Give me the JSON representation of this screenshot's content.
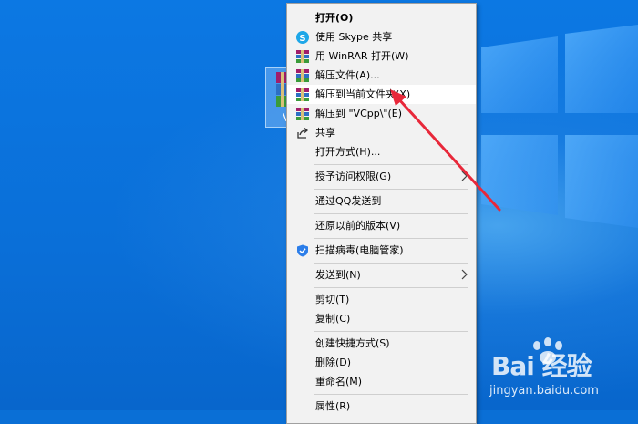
{
  "desktop": {
    "file_label": "V"
  },
  "context_menu": {
    "items": [
      {
        "label": "打开(O)",
        "icon": "none"
      },
      {
        "label": "使用 Skype 共享",
        "icon": "skype-icon"
      },
      {
        "label": "用 WinRAR 打开(W)",
        "icon": "winrar-icon"
      },
      {
        "label": "解压文件(A)...",
        "icon": "winrar-icon"
      },
      {
        "label": "解压到当前文件夹(X)",
        "icon": "winrar-icon"
      },
      {
        "label": "解压到 \"VCpp\\\"(E)",
        "icon": "winrar-icon"
      },
      {
        "label": "共享",
        "icon": "share-icon"
      },
      {
        "label": "打开方式(H)...",
        "icon": "none"
      },
      {
        "label": "授予访问权限(G)",
        "icon": "none",
        "submenu": true
      },
      {
        "label": "通过QQ发送到",
        "icon": "none"
      },
      {
        "label": "还原以前的版本(V)",
        "icon": "none"
      },
      {
        "label": "扫描病毒(电脑管家)",
        "icon": "shield-icon"
      },
      {
        "label": "发送到(N)",
        "icon": "none",
        "submenu": true
      },
      {
        "label": "剪切(T)",
        "icon": "none"
      },
      {
        "label": "复制(C)",
        "icon": "none"
      },
      {
        "label": "创建快捷方式(S)",
        "icon": "none"
      },
      {
        "label": "删除(D)",
        "icon": "none"
      },
      {
        "label": "重命名(M)",
        "icon": "none"
      },
      {
        "label": "属性(R)",
        "icon": "none"
      }
    ],
    "highlighted_item": "解压到当前文件夹(X)"
  },
  "watermark": {
    "brand": "Bai 经验",
    "url": "jingyan.baidu.com"
  },
  "colors": {
    "desktop_blue": "#0a6fd6",
    "menu_bg": "#f2f2f2",
    "annotation_arrow": "#e8283a"
  }
}
